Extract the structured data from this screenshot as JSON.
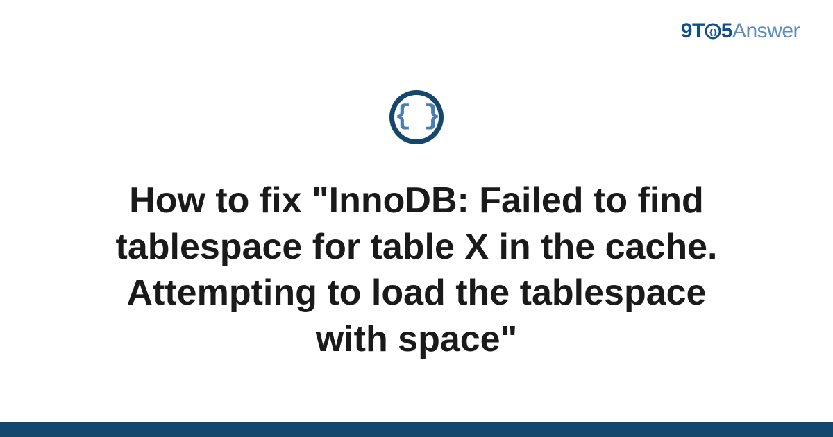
{
  "logo": {
    "nine": "9",
    "t": "T",
    "five": "5",
    "answer": "Answer"
  },
  "icon": {
    "name": "code-braces-icon",
    "glyph": "{ }"
  },
  "title": "How to fix \"InnoDB: Failed to find tablespace for table X in the cache. Attempting to load the tablespace with space\"",
  "colors": {
    "brand_dark": "#14476b",
    "brand_light": "#5a8bc4",
    "logo_primary": "#0d4f8b"
  }
}
